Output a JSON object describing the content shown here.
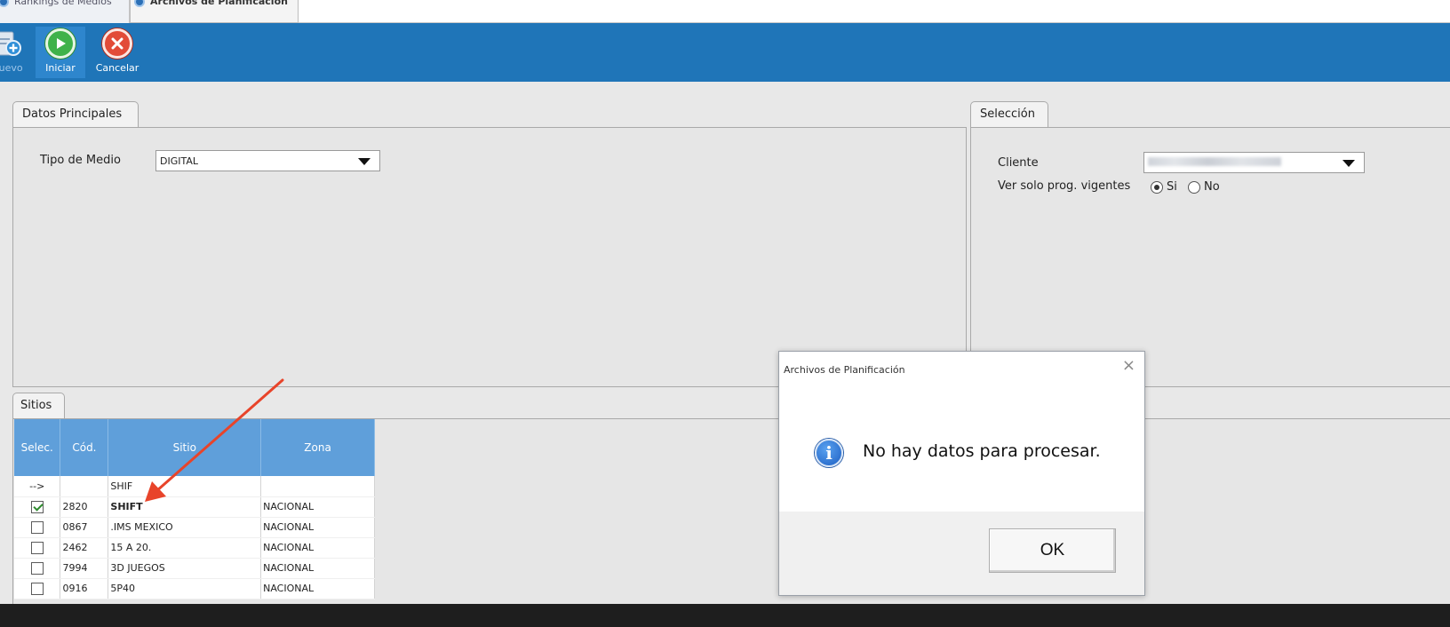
{
  "tabs": [
    {
      "label": "Rankings de Medios"
    },
    {
      "label": "Archivos de Planificación"
    }
  ],
  "toolbar": {
    "nuevo_label": "Nuevo",
    "iniciar_label": "Iniciar",
    "cancelar_label": "Cancelar",
    "colors": {
      "bar": "#1f75b8",
      "iniciar": "#3fb24a",
      "cancelar": "#e24b38"
    }
  },
  "datos": {
    "tab_label": "Datos Principales",
    "tipo_medio_label": "Tipo de Medio",
    "tipo_medio_value": "DIGITAL"
  },
  "seleccion": {
    "tab_label": "Selección",
    "cliente_label": "Cliente",
    "ver_solo_label": "Ver solo prog. vigentes",
    "si_label": "Si",
    "no_label": "No"
  },
  "sitios": {
    "tab_label": "Sitios",
    "columns": [
      "Selec.",
      "Cód.",
      "Sitio",
      "Zona"
    ],
    "filter_row": {
      "sel": "-->",
      "cod": "",
      "sitio": "SHIF",
      "zona": ""
    },
    "rows": [
      {
        "checked": true,
        "cod": "2820",
        "sitio": "SHIFT",
        "zona": "NACIONAL"
      },
      {
        "checked": false,
        "cod": "0867",
        "sitio": ".IMS MEXICO",
        "zona": "NACIONAL"
      },
      {
        "checked": false,
        "cod": "2462",
        "sitio": "15 A 20.",
        "zona": "NACIONAL"
      },
      {
        "checked": false,
        "cod": "7994",
        "sitio": "3D JUEGOS",
        "zona": "NACIONAL"
      },
      {
        "checked": false,
        "cod": "0916",
        "sitio": "5P40",
        "zona": "NACIONAL"
      }
    ]
  },
  "dialog": {
    "title": "Archivos de Planificación",
    "close_glyph": "×",
    "message": "No hay datos para procesar.",
    "ok_label": "OK",
    "icon": "info-icon"
  },
  "annotation": {
    "color": "#e8442a",
    "icon": "arrow-annotation"
  }
}
